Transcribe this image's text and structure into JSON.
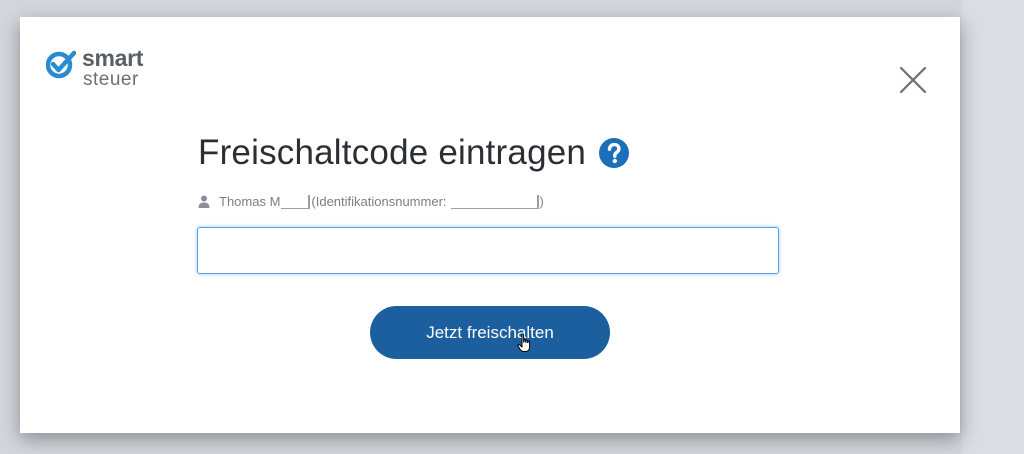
{
  "logo": {
    "line1": "smart",
    "line2": "steuer",
    "mark_icon": "check-circle-icon",
    "brand_color": "#2a8bd0"
  },
  "dialog": {
    "title": "Freischaltcode eintragen",
    "help_icon": "question-circle-icon",
    "close_icon": "close-icon",
    "user": {
      "icon": "user-icon",
      "name": "Thomas M",
      "id_prefix": "(Identifikationsnummer:",
      "id_suffix": ")"
    },
    "code_input": {
      "value": "",
      "placeholder": ""
    },
    "submit_label": "Jetzt freischalten"
  },
  "colors": {
    "button": "#1b5f9e",
    "input_focus": "#5aa3e0",
    "help": "#1a6fb8"
  }
}
